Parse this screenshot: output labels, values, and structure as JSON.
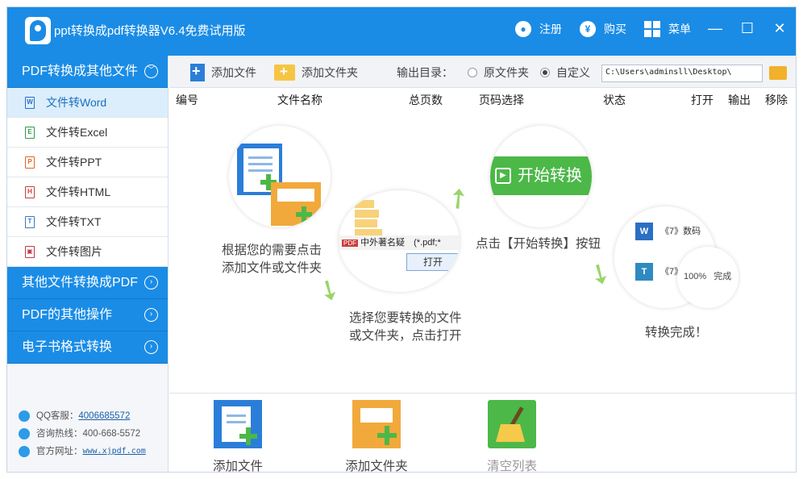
{
  "titlebar": {
    "title": "ppt转换成pdf转换器V6.4免费试用版",
    "register": "注册",
    "buy": "购买",
    "menu": "菜单",
    "minimize": "—",
    "maximize": "☐",
    "close": "✕"
  },
  "sidebar": {
    "section1": "PDF转换成其他文件",
    "items": [
      {
        "label": "文件转Word",
        "icon": "W",
        "color": "#2b6fc4"
      },
      {
        "label": "文件转Excel",
        "icon": "E",
        "color": "#2e9a4a"
      },
      {
        "label": "文件转PPT",
        "icon": "P",
        "color": "#d8691f"
      },
      {
        "label": "文件转HTML",
        "icon": "H",
        "color": "#c93d3d"
      },
      {
        "label": "文件转TXT",
        "icon": "T",
        "color": "#3a79c0"
      },
      {
        "label": "文件转图片",
        "icon": "▣",
        "color": "#c0394a"
      }
    ],
    "section2": "其他文件转换成PDF",
    "section3": "PDF的其他操作",
    "section4": "电子书格式转换",
    "qq_label": "QQ客服：",
    "qq_value": "4006685572",
    "hotline_label": "咨询热线：",
    "hotline_value": "400-668-5572",
    "site_label": "官方网址：",
    "site_value": "www.xjpdf.com"
  },
  "toolbar": {
    "add_file": "添加文件",
    "add_folder": "添加文件夹",
    "output_label": "输出目录：",
    "radio_original": "原文件夹",
    "radio_custom": "自定义",
    "path": "C:\\Users\\adminsll\\Desktop\\"
  },
  "table": {
    "columns": [
      "编号",
      "文件名称",
      "总页数",
      "页码选择",
      "状态",
      "打开",
      "输出",
      "移除"
    ]
  },
  "guide": {
    "step1": "根据您的需要点击\n添加文件或文件夹",
    "step2": "选择您要转换的文件\n或文件夹，点击打开",
    "step2_file": "中外著名疑",
    "step2_ext": "(*.pdf;*",
    "step2_button": "打开",
    "step3": "点击【开始转换】按钮",
    "step3_button": "开始转换",
    "step4": "转换完成！",
    "step4_row1": "《7》数码",
    "step4_row2": "《7》",
    "step4_progress": "100%",
    "step4_done": "完成"
  },
  "actions": {
    "add_file": "添加文件",
    "add_folder": "添加文件夹",
    "clear_list": "清空列表"
  }
}
